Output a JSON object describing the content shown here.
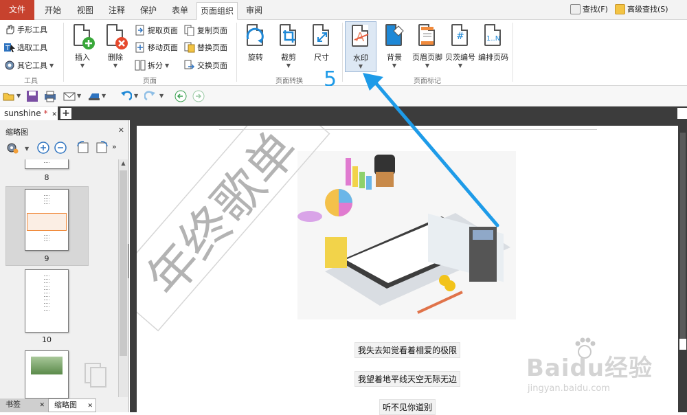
{
  "menu_tabs": [
    {
      "label": "文件",
      "kind": "file"
    },
    {
      "label": "开始"
    },
    {
      "label": "视图"
    },
    {
      "label": "注释"
    },
    {
      "label": "保护"
    },
    {
      "label": "表单"
    },
    {
      "label": "页面组织",
      "active": true
    },
    {
      "label": "审阅"
    }
  ],
  "find": {
    "find_label": "查找(F)",
    "advanced_find_label": "高级查找(S)"
  },
  "ribbon": {
    "tools": {
      "hand": "手形工具",
      "select": "选取工具",
      "other": "其它工具",
      "group": "工具"
    },
    "pages": {
      "insert": "插入",
      "delete": "删除",
      "extract": "提取页面",
      "move": "移动页面",
      "split": "拆分",
      "copy": "复制页面",
      "replace": "替换页面",
      "swap": "交换页面",
      "group": "页面"
    },
    "transform": {
      "rotate": "旋转",
      "crop": "裁剪",
      "size": "尺寸",
      "group": "页面转换"
    },
    "marks": {
      "watermark": "水印",
      "background": "背景",
      "header_footer": "页眉页脚",
      "bates": "贝茨编号",
      "page_numbers": "编排页码",
      "group": "页面标记"
    }
  },
  "step_number": "5",
  "document_tab": {
    "name": "sunshine",
    "modified_marker": "*"
  },
  "thumbnail_panel": {
    "title": "缩略图",
    "pages": [
      "8",
      "9",
      "10"
    ],
    "selected_page": "9"
  },
  "bottom_tabs": {
    "bookmarks": "书签",
    "thumbnails": "缩略图"
  },
  "page_content": {
    "watermark_text": "年终歌单",
    "lines": [
      "我失去知觉看着相爱的极限",
      "我望着地平线天空无际无边",
      "听不见你道别"
    ]
  },
  "site_watermark": {
    "brand": "Baidu经验",
    "url": "jingyan.baidu.com"
  },
  "colors": {
    "file_tab": "#c7422e",
    "accent_arrow": "#1e9be8",
    "orange_highlight": "#f08a3c"
  }
}
